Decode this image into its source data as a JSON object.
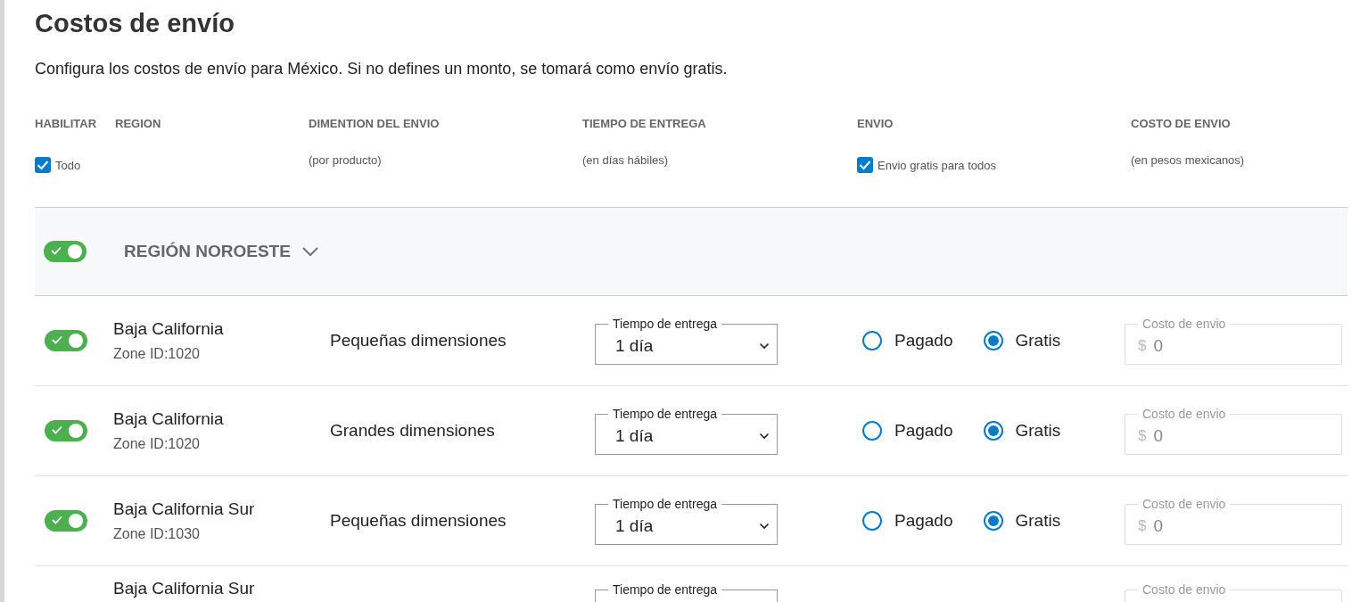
{
  "title": "Costos de envío",
  "description": "Configura los costos de envío para México. Si no defines un monto, se tomará como envío gratis.",
  "columns": [
    {
      "label": "HABILITAR"
    },
    {
      "label": "REGION"
    },
    {
      "label": "DIMENTION DEL ENVIO",
      "sub": "(por producto)"
    },
    {
      "label": "TIEMPO DE ENTREGA",
      "sub": "(en días hábiles)"
    },
    {
      "label": "ENVIO"
    },
    {
      "label": "COSTO DE ENVIO",
      "sub": "(en pesos mexicanos)"
    }
  ],
  "enable_all": {
    "label": "Todo",
    "checked": true
  },
  "free_all": {
    "label": "Envio gratis para todos",
    "checked": true
  },
  "region": {
    "name": "REGIÓN NOROESTE",
    "on": true,
    "expanded": true
  },
  "rows": [
    {
      "kind": "full",
      "name": "Baja California",
      "zone": "Zone ID:1020",
      "on": true,
      "dimension": "Pequeñas dimensiones",
      "time_label": "Tiempo de entrega",
      "time": "1 día",
      "options": [
        {
          "label": "Pagado",
          "selected": false
        },
        {
          "label": "Gratis",
          "selected": true
        }
      ],
      "cost_label": "Costo de envio",
      "currency": "$",
      "cost": "0"
    },
    {
      "kind": "full",
      "name": "Baja California",
      "zone": "Zone ID:1020",
      "on": true,
      "dimension": "Grandes dimensiones",
      "time_label": "Tiempo de entrega",
      "time": "1 día",
      "options": [
        {
          "label": "Pagado",
          "selected": false
        },
        {
          "label": "Gratis",
          "selected": true
        }
      ],
      "cost_label": "Costo de envio",
      "currency": "$",
      "cost": "0"
    },
    {
      "kind": "full",
      "name": "Baja California Sur",
      "zone": "Zone ID:1030",
      "on": true,
      "dimension": "Pequeñas dimensiones",
      "time_label": "Tiempo de entrega",
      "time": "1 día",
      "options": [
        {
          "label": "Pagado",
          "selected": false
        },
        {
          "label": "Gratis",
          "selected": true
        }
      ],
      "cost_label": "Costo de envio",
      "currency": "$",
      "cost": "0"
    },
    {
      "kind": "cut",
      "name": "Baja California Sur",
      "time_label": "Tiempo de entrega",
      "cost_label": "Costo de envio"
    }
  ]
}
